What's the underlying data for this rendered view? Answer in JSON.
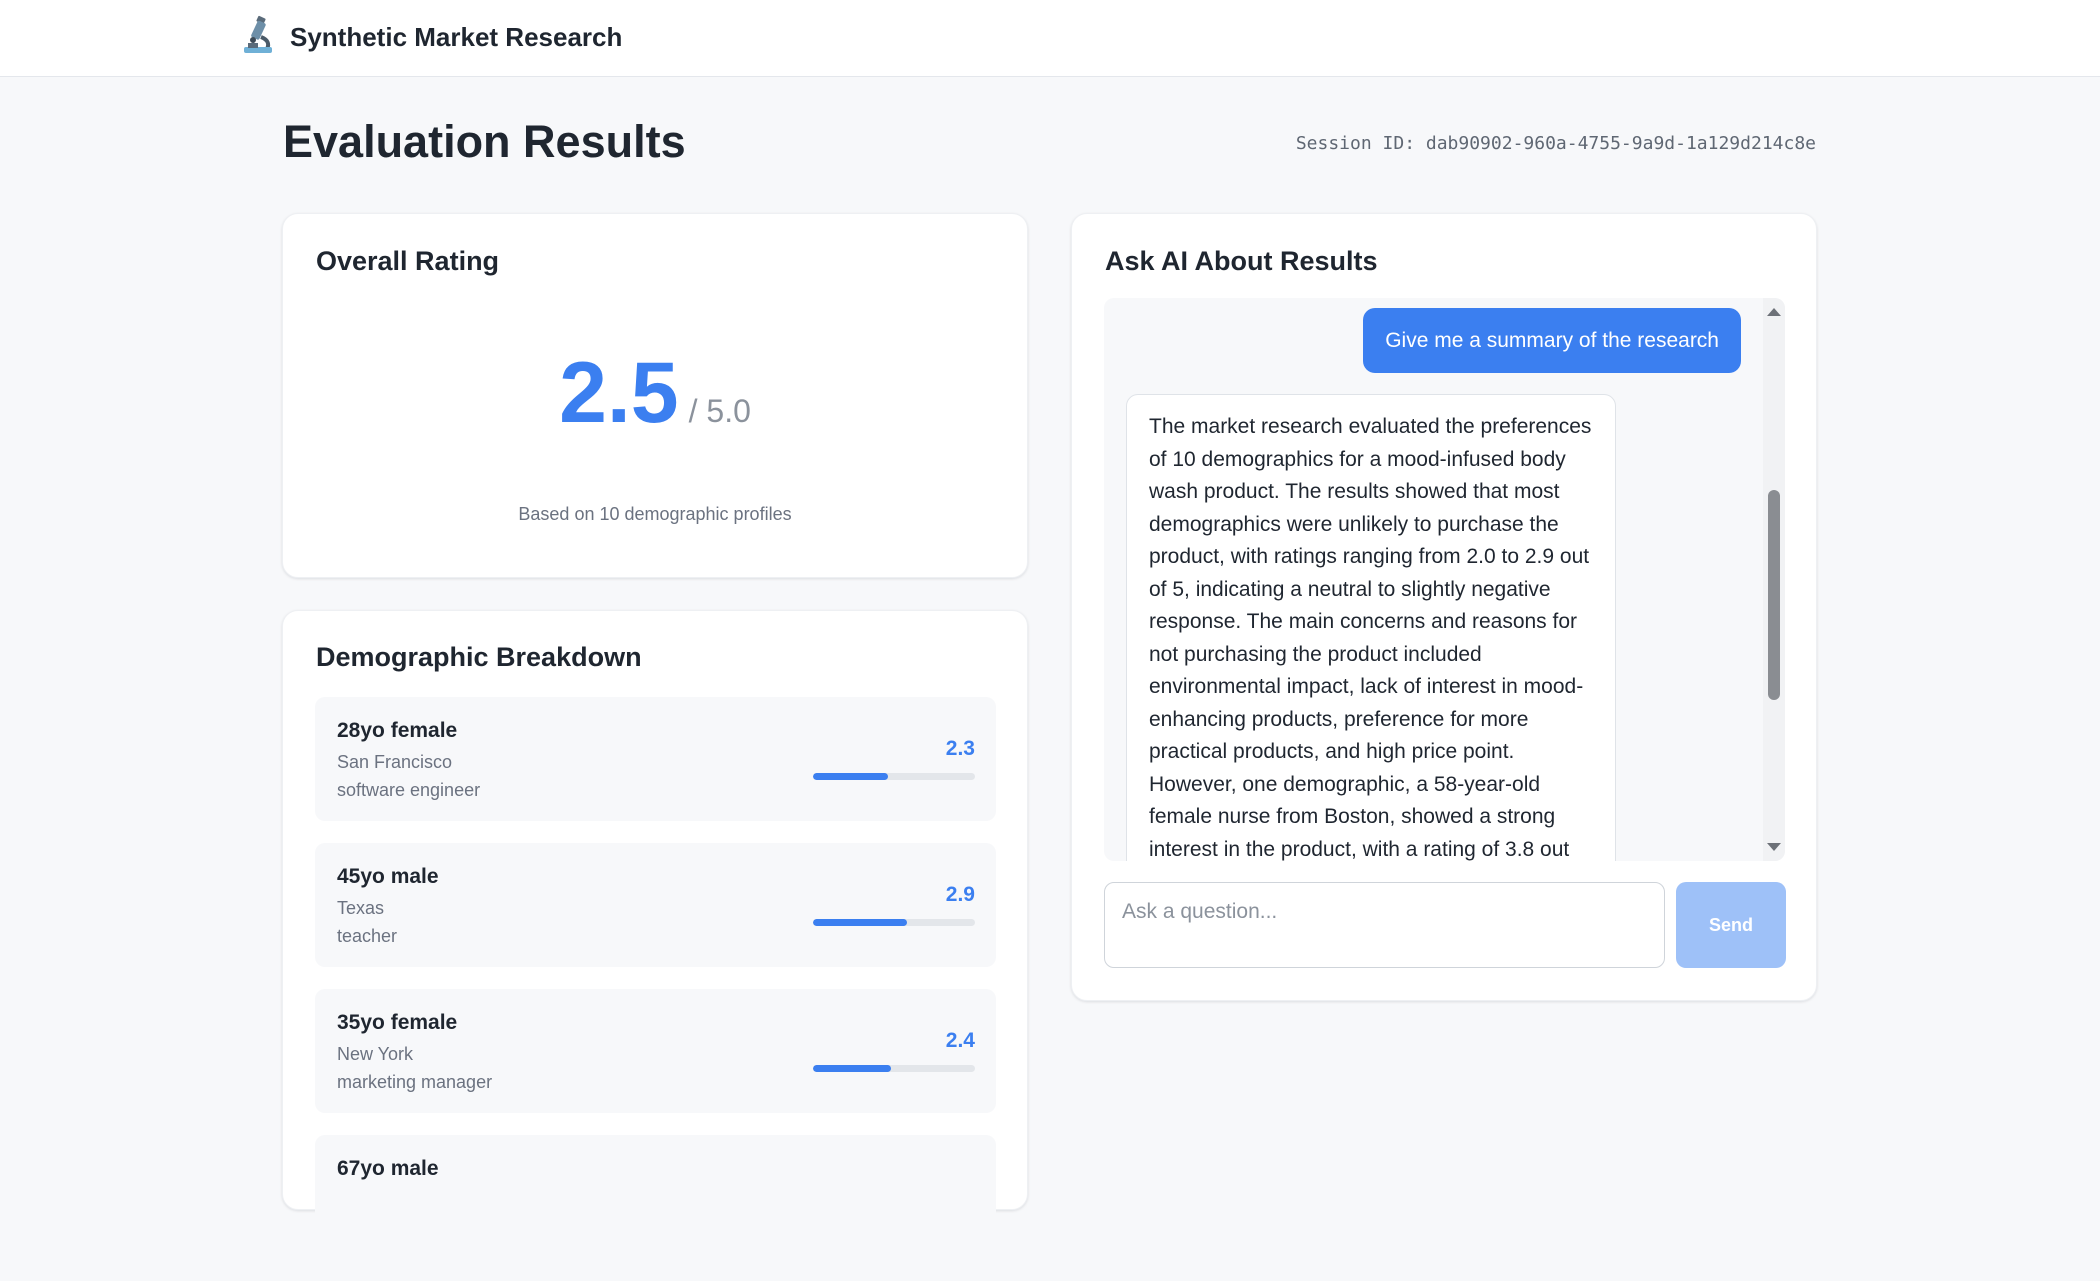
{
  "header": {
    "icon": "microscope-icon",
    "title": "Synthetic Market Research"
  },
  "page": {
    "title": "Evaluation Results",
    "session": "Session ID: dab90902-960a-4755-9a9d-1a129d214c8e"
  },
  "rating": {
    "heading": "Overall Rating",
    "value": "2.5",
    "max": "/ 5.0",
    "caption": "Based on 10 demographic profiles"
  },
  "demographics": {
    "heading": "Demographic Breakdown",
    "items": [
      {
        "name": "28yo female",
        "location": "San Francisco",
        "job": "software engineer",
        "score": "2.3",
        "fraction": 0.46
      },
      {
        "name": "45yo male",
        "location": "Texas",
        "job": "teacher",
        "score": "2.9",
        "fraction": 0.58
      },
      {
        "name": "35yo female",
        "location": "New York",
        "job": "marketing manager",
        "score": "2.4",
        "fraction": 0.48
      },
      {
        "name": "67yo male",
        "location": "",
        "job": "",
        "score": "",
        "fraction": 0
      }
    ]
  },
  "chat": {
    "heading": "Ask AI About Results",
    "user_message": "Give me a summary of the research",
    "ai_message": "The market research evaluated the preferences of 10 demographics for a mood-infused body wash product. The results showed that most demographics were unlikely to purchase the product, with ratings ranging from 2.0 to 2.9 out of 5, indicating a neutral to slightly negative response. The main concerns and reasons for not purchasing the product included environmental impact, lack of interest in mood-enhancing products, preference for more practical products, and high price point. However, one demographic, a 58-year-old female nurse from Boston, showed a strong interest in the product, with a rating of 3.8 out",
    "input_placeholder": "Ask a question...",
    "send_label": "Send"
  },
  "colors": {
    "accent": "#3b7ff0",
    "send_disabled": "#9ec1f8"
  }
}
